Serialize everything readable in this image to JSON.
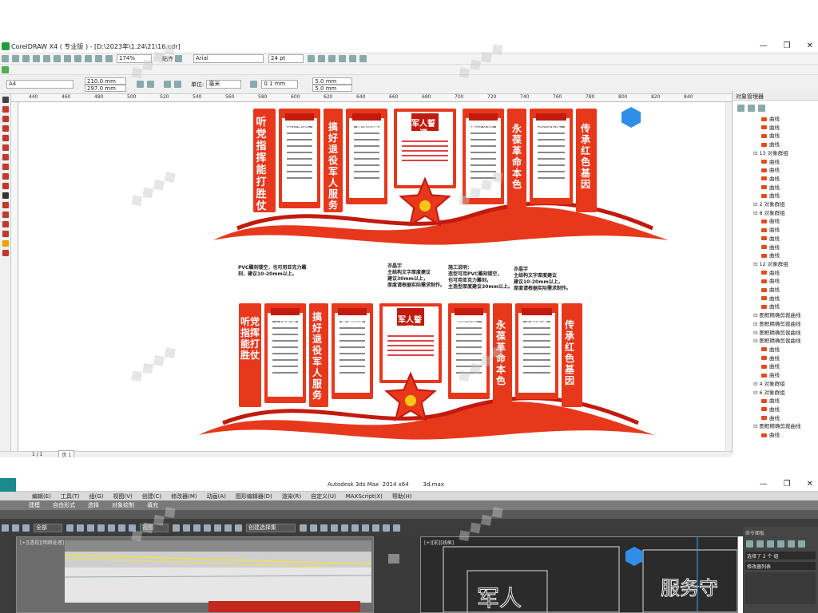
{
  "corel": {
    "title": "CorelDRAW X4 ( 专业版 ) - [D:\\2023年\\1.24\\21\\16.cdr]",
    "zoom": "174%",
    "paste_label": "贴齐",
    "font": "Arial",
    "font_size": "24 pt",
    "page_size": "A4",
    "width": "210.0 mm",
    "height": "297.0 mm",
    "unit_label": "单位:",
    "unit": "毫米",
    "nudge": "0.1 mm",
    "dup_x": "5.0 mm",
    "dup_y": "5.0 mm",
    "ruler_ticks": [
      "440",
      "460",
      "480",
      "500",
      "520",
      "540",
      "560",
      "580",
      "600",
      "620",
      "640",
      "660",
      "680",
      "700",
      "720",
      "740",
      "760",
      "780",
      "800",
      "820",
      "840"
    ],
    "page_nav": "1 / 1",
    "page_tab": "页 1",
    "object_manager": {
      "title": "对象管理器",
      "items": [
        {
          "type": "c",
          "label": "曲线"
        },
        {
          "type": "c",
          "label": "曲线"
        },
        {
          "type": "c",
          "label": "曲线"
        },
        {
          "type": "c",
          "label": "曲线"
        },
        {
          "type": "g",
          "label": "13 对象群组"
        },
        {
          "type": "c",
          "label": "曲线"
        },
        {
          "type": "c",
          "label": "曲线"
        },
        {
          "type": "c",
          "label": "曲线"
        },
        {
          "type": "c",
          "label": "曲线"
        },
        {
          "type": "c",
          "label": "曲线"
        },
        {
          "type": "g",
          "label": "2 对象群组"
        },
        {
          "type": "g",
          "label": "8 对象群组"
        },
        {
          "type": "c",
          "label": "曲线"
        },
        {
          "type": "c",
          "label": "曲线"
        },
        {
          "type": "c",
          "label": "曲线"
        },
        {
          "type": "c",
          "label": "曲线"
        },
        {
          "type": "c",
          "label": "曲线"
        },
        {
          "type": "g",
          "label": "12 对象群组"
        },
        {
          "type": "c",
          "label": "曲线"
        },
        {
          "type": "c",
          "label": "曲线"
        },
        {
          "type": "c",
          "label": "曲线"
        },
        {
          "type": "c",
          "label": "曲线"
        },
        {
          "type": "c",
          "label": "曲线"
        },
        {
          "type": "g",
          "label": "图框精确剪裁曲线"
        },
        {
          "type": "g",
          "label": "图框精确剪裁曲线"
        },
        {
          "type": "g",
          "label": "图框精确剪裁曲线"
        },
        {
          "type": "g",
          "label": "图框精确剪裁曲线"
        },
        {
          "type": "c",
          "label": "曲线"
        },
        {
          "type": "c",
          "label": "曲线"
        },
        {
          "type": "c",
          "label": "曲线"
        },
        {
          "type": "c",
          "label": "曲线"
        },
        {
          "type": "g",
          "label": "4 对象群组"
        },
        {
          "type": "g",
          "label": "6 对象群组"
        },
        {
          "type": "c",
          "label": "曲线"
        },
        {
          "type": "c",
          "label": "曲线"
        },
        {
          "type": "c",
          "label": "曲线"
        },
        {
          "type": "g",
          "label": "图框精确剪裁曲线"
        },
        {
          "type": "c",
          "label": "曲线"
        }
      ]
    }
  },
  "design": {
    "panels": {
      "p1": "听党指挥 能打胜仗",
      "p2": "工作职责",
      "p3": "搞好退役军人服务",
      "p4": "管理制度",
      "p5": "军人誓词",
      "p6": "服务守则",
      "p7": "永葆革命本色",
      "p8": "文明用语",
      "p9": "传承红色基因"
    },
    "notes": {
      "n1": "PVC雕刻镂空，也可用亚克力雕刻，建议10-20mm以上。",
      "n2": "亦晶字\n主结构文字厚度建议\n建议30mm以上，\n厚度请根据实际需求制作。",
      "n3": "施工说明：\n造型可用PVC雕刻镂空，\n也可用亚克力雕刻，\n主造型厚度建议30mm以上。",
      "n4": "亦晶字\n主结构文字厚度建议\n建议10-20mm以上，\n厚度请根据实际需求制作。"
    }
  },
  "max": {
    "title": "Autodesk 3ds Max  2014 x64        3d.max",
    "menu": [
      "编辑(E)",
      "工具(T)",
      "组(G)",
      "视图(V)",
      "创建(C)",
      "修改器(M)",
      "动画(A)",
      "图形编辑器(D)",
      "渲染(R)",
      "自定义(U)",
      "MAXScript(X)",
      "帮助(H)"
    ],
    "ribbon": [
      "建模",
      "自由形式",
      "选择",
      "对象绘制",
      "填充"
    ],
    "filter": "全部",
    "view": "视图",
    "selection_set": "创建选择集",
    "vp1_label": "[+][透视][明暗处理]",
    "vp2_label": "[+][前][线框]",
    "cmd_label": "命令面板",
    "selection_filter": "选择了 2 个 组",
    "modifier_list": "修改器列表"
  },
  "colors": {
    "accent": "#e8381c",
    "dark_red": "#c21a0d",
    "gold": "#f5c518"
  }
}
